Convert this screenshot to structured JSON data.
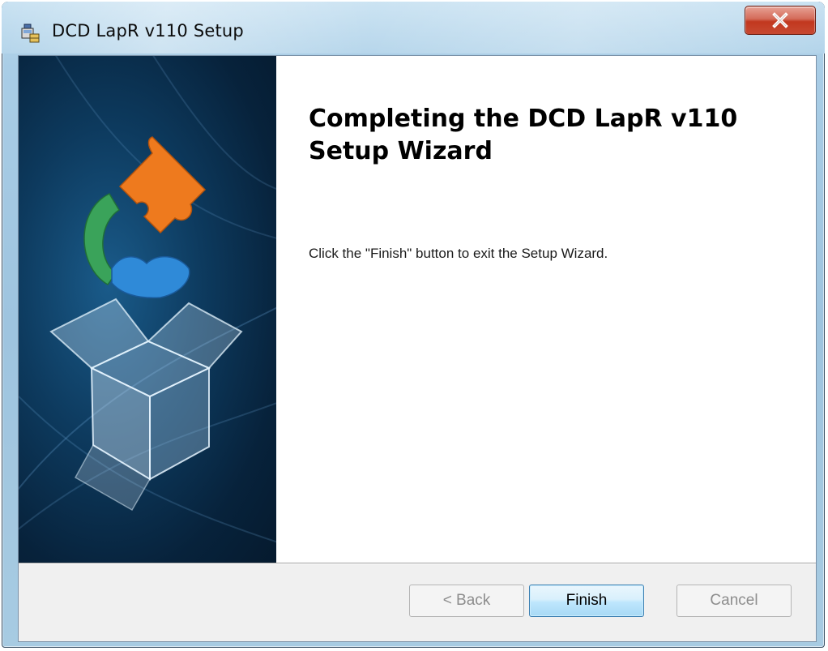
{
  "window": {
    "title": "DCD LapR v110 Setup",
    "icon": "installer-icon",
    "close_icon": "close-icon"
  },
  "banner": {
    "image": "puzzle-box-graphic"
  },
  "content": {
    "heading": "Completing the DCD LapR v110 Setup Wizard",
    "message": "Click the \"Finish\" button to exit the Setup Wizard."
  },
  "buttons": {
    "back_label": "< Back",
    "finish_label": "Finish",
    "cancel_label": "Cancel"
  },
  "colors": {
    "banner_dark": "#07223b",
    "primary_button_border": "#3c7fb1",
    "close_button_red": "#c2381f",
    "footer_bg": "#f0f0f0"
  }
}
